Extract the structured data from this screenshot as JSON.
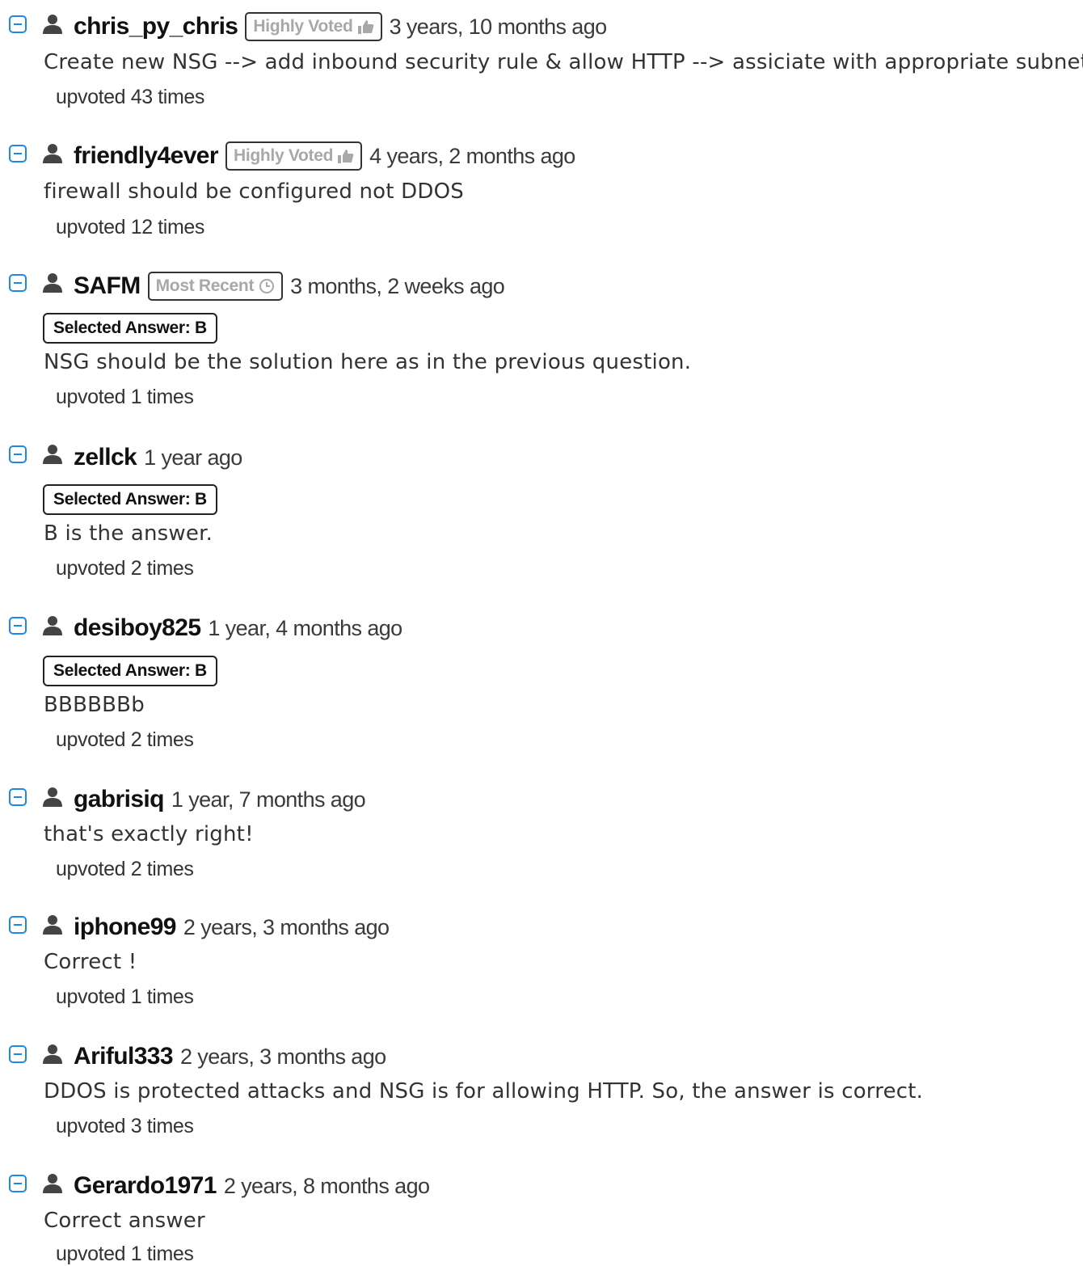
{
  "comments": [
    {
      "username": "chris_py_chris",
      "badge": "Highly Voted",
      "badge_icon": "thumbs-up-icon",
      "date": "3 years, 10 months ago",
      "selected_answer": "",
      "text": "Create new NSG --> add inbound security rule & allow HTTP --> assiciate with appropriate subnet",
      "upvotes": "upvoted 43 times"
    },
    {
      "username": "friendly4ever",
      "badge": "Highly Voted",
      "badge_icon": "thumbs-up-icon",
      "date": "4 years, 2 months ago",
      "selected_answer": "",
      "text": "firewall should be configured not DDOS",
      "upvotes": "upvoted 12 times"
    },
    {
      "username": "SAFM",
      "badge": "Most Recent",
      "badge_icon": "clock-icon",
      "date": "3 months, 2 weeks ago",
      "selected_answer": "Selected Answer: B",
      "text": "NSG should be the solution here as in the previous question.",
      "upvotes": "upvoted 1 times"
    },
    {
      "username": "zellck",
      "badge": "",
      "date": "1 year ago",
      "selected_answer": "Selected Answer: B",
      "text": "B is the answer.",
      "upvotes": "upvoted 2 times"
    },
    {
      "username": "desiboy825",
      "badge": "",
      "date": "1 year, 4 months ago",
      "selected_answer": "Selected Answer: B",
      "text": "BBBBBBb",
      "upvotes": "upvoted 2 times"
    },
    {
      "username": "gabrisiq",
      "badge": "",
      "date": "1 year, 7 months ago",
      "selected_answer": "",
      "text": "that's exactly right!",
      "upvotes": "upvoted 2 times"
    },
    {
      "username": "iphone99",
      "badge": "",
      "date": "2 years, 3 months ago",
      "selected_answer": "",
      "text": "Correct !",
      "upvotes": "upvoted 1 times"
    },
    {
      "username": "Ariful333",
      "badge": "",
      "date": "2 years, 3 months ago",
      "selected_answer": "",
      "text": "DDOS is protected attacks and NSG is for allowing HTTP. So, the answer is correct.",
      "upvotes": "upvoted 3 times"
    },
    {
      "username": "Gerardo1971",
      "badge": "",
      "date": "2 years, 8 months ago",
      "selected_answer": "",
      "text": "Correct answer",
      "upvotes": "upvoted 1 times"
    }
  ]
}
